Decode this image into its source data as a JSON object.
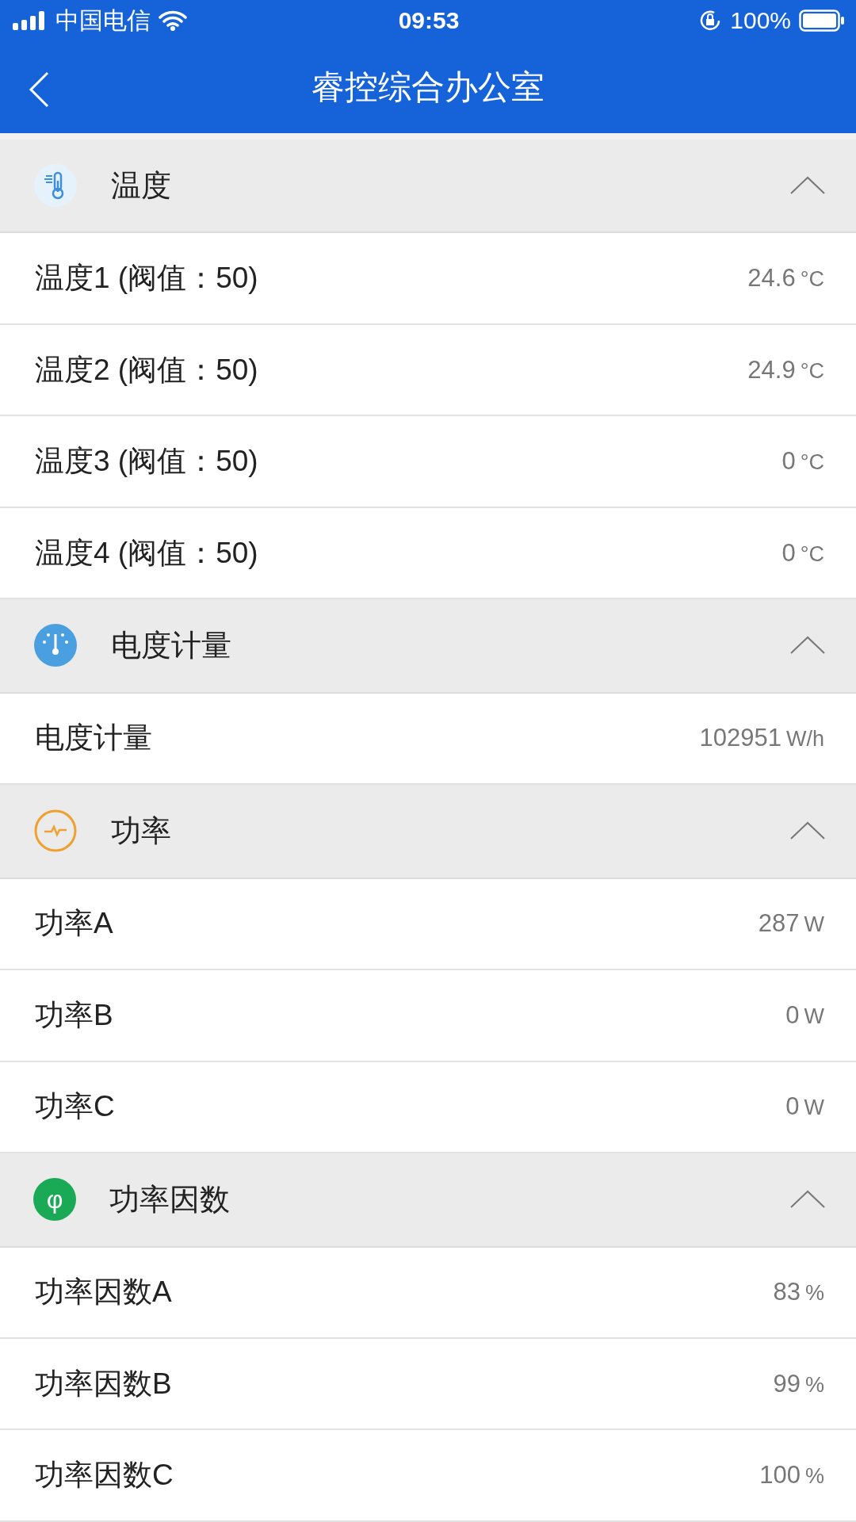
{
  "status_bar": {
    "carrier": "中国电信",
    "time": "09:53",
    "battery": "100%"
  },
  "nav": {
    "title": "睿控综合办公室"
  },
  "sections": [
    {
      "kind": "temperature",
      "title": "温度",
      "expanded": true,
      "rows": [
        {
          "label": "温度1 (阀值：50)",
          "value": "24.6",
          "unit": "°C"
        },
        {
          "label": "温度2 (阀值：50)",
          "value": "24.9",
          "unit": "°C"
        },
        {
          "label": "温度3 (阀值：50)",
          "value": "0",
          "unit": "°C"
        },
        {
          "label": "温度4 (阀值：50)",
          "value": "0",
          "unit": "°C"
        }
      ]
    },
    {
      "kind": "energy",
      "title": "电度计量",
      "expanded": true,
      "rows": [
        {
          "label": "电度计量",
          "value": "102951",
          "unit": "W/h"
        }
      ]
    },
    {
      "kind": "power",
      "title": "功率",
      "expanded": true,
      "rows": [
        {
          "label": "功率A",
          "value": "287",
          "unit": "W"
        },
        {
          "label": "功率B",
          "value": "0",
          "unit": "W"
        },
        {
          "label": "功率C",
          "value": "0",
          "unit": "W"
        }
      ]
    },
    {
      "kind": "factor",
      "title": "功率因数",
      "icon_text": "φ",
      "expanded": true,
      "rows": [
        {
          "label": "功率因数A",
          "value": "83",
          "unit": "%"
        },
        {
          "label": "功率因数B",
          "value": "99",
          "unit": "%"
        },
        {
          "label": "功率因数C",
          "value": "100",
          "unit": "%"
        }
      ]
    }
  ]
}
